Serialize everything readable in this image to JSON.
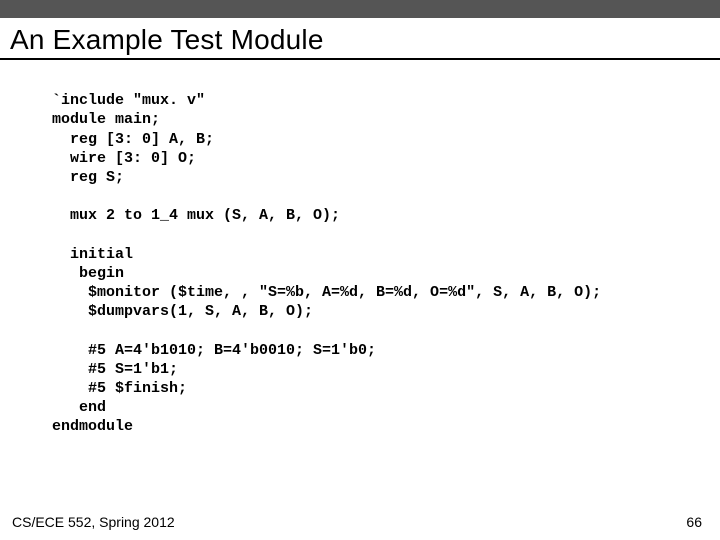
{
  "slide": {
    "title": "An Example Test Module",
    "footer_left": "CS/ECE 552, Spring 2012",
    "footer_right": "66"
  },
  "code": {
    "l01": "`include \"mux. v\"",
    "l02": "module main;",
    "l03": "  reg [3: 0] A, B;",
    "l04": "  wire [3: 0] O;",
    "l05": "  reg S;",
    "l06": "",
    "l07": "  mux 2 to 1_4 mux (S, A, B, O);",
    "l08": "",
    "l09": "  initial",
    "l10": "   begin",
    "l11": "    $monitor ($time, , \"S=%b, A=%d, B=%d, O=%d\", S, A, B, O);",
    "l12": "    $dumpvars(1, S, A, B, O);",
    "l13": "",
    "l14": "    #5 A=4'b1010; B=4'b0010; S=1'b0;",
    "l15": "    #5 S=1'b1;",
    "l16": "    #5 $finish;",
    "l17": "   end",
    "l18": "endmodule"
  }
}
